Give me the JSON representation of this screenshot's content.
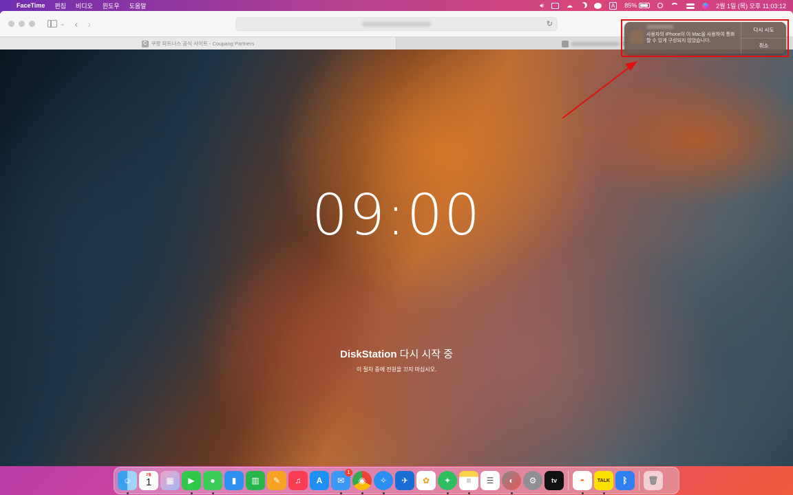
{
  "menubar": {
    "app_name": "FaceTime",
    "menus": [
      "편집",
      "비디오",
      "윈도우",
      "도움말"
    ],
    "input_letter": "A",
    "battery_percent": "85%",
    "datetime": "2월 1일 (목) 오후 11:03:12"
  },
  "browser": {
    "tabs": [
      {
        "favicon": "C",
        "label": "쿠팡 파트너스 공식 사이트 - Coupang Partners"
      },
      {
        "favicon": "",
        "label": "Di"
      }
    ]
  },
  "page": {
    "clock": "09:00",
    "restart_brand": "DiskStation",
    "restart_text": " 다시 시작 중",
    "restart_sub": "이 절차 중에 전원을 끄지 마십시오."
  },
  "notification": {
    "message": "사용자의 iPhone이 이 Mac을 사용하여 통화할 수 있게 구성되지 않았습니다.",
    "retry_label": "다시 시도",
    "cancel_label": "취소"
  },
  "dock": {
    "calendar_month": "2월",
    "calendar_day": "1",
    "mail_badge": "1",
    "tv_label": "tv",
    "talk_label": "TALK"
  },
  "colors": {
    "highlight": "#e01010",
    "accent_dock": "#ff3b30"
  }
}
